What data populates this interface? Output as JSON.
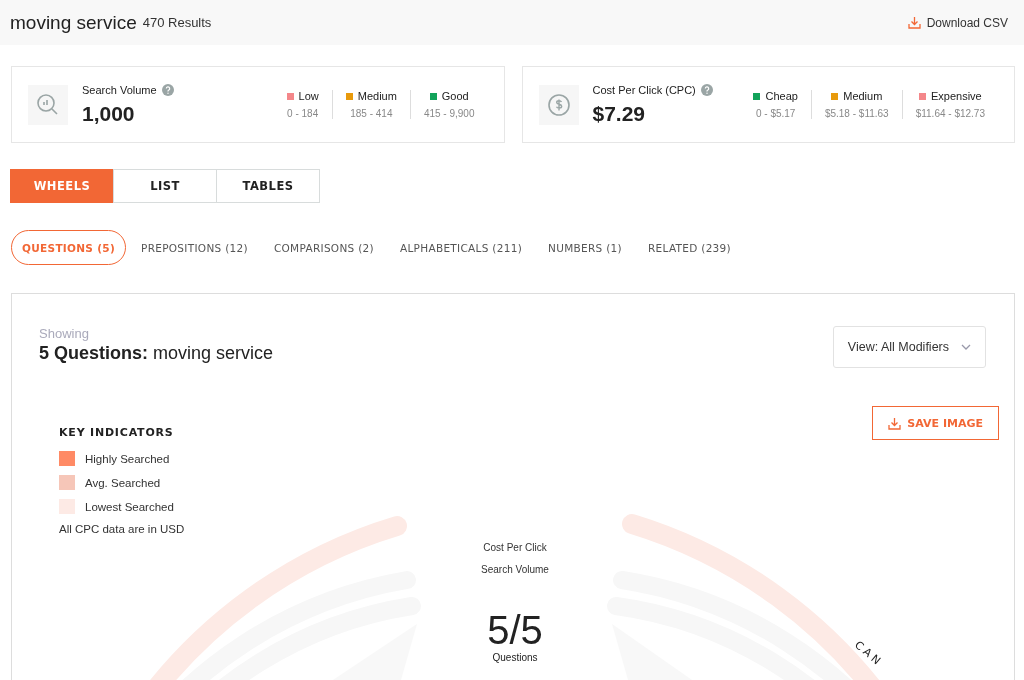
{
  "header": {
    "keyword": "moving service",
    "results": "470 Results",
    "download": "Download CSV"
  },
  "metrics": [
    {
      "kind": "volume",
      "label": "Search Volume",
      "value": "1,000",
      "ranges": [
        {
          "name": "Low",
          "range": "0 - 184",
          "color": "#f4878a"
        },
        {
          "name": "Medium",
          "range": "185 - 414",
          "color": "#e89a0c"
        },
        {
          "name": "Good",
          "range": "415 - 9,900",
          "color": "#12a35a"
        }
      ]
    },
    {
      "kind": "cpc",
      "label": "Cost Per Click (CPC)",
      "value": "$7.29",
      "ranges": [
        {
          "name": "Cheap",
          "range": "0 - $5.17",
          "color": "#12a35a"
        },
        {
          "name": "Medium",
          "range": "$5.18 - $11.63",
          "color": "#e89a0c"
        },
        {
          "name": "Expensive",
          "range": "$11.64 - $12.73",
          "color": "#f4878a"
        }
      ]
    }
  ],
  "views": [
    {
      "label": "WHEELS",
      "selected": true
    },
    {
      "label": "LIST",
      "selected": false
    },
    {
      "label": "TABLES",
      "selected": false
    }
  ],
  "categories": [
    {
      "label": "QUESTIONS (5)",
      "selected": true
    },
    {
      "label": "PREPOSITIONS (12)",
      "selected": false
    },
    {
      "label": "COMPARISONS (2)",
      "selected": false
    },
    {
      "label": "ALPHABETICALS (211)",
      "selected": false
    },
    {
      "label": "NUMBERS (1)",
      "selected": false
    },
    {
      "label": "RELATED (239)",
      "selected": false
    }
  ],
  "panel": {
    "showing": "Showing",
    "count": "5 Questions:",
    "keyword": "moving service",
    "view_select": "View: All Modifiers",
    "save": "SAVE IMAGE",
    "key_title": "KEY INDICATORS",
    "key_items": [
      {
        "label": "Highly Searched",
        "color": "#ff8a65"
      },
      {
        "label": "Avg. Searched",
        "color": "#f6c6b8"
      },
      {
        "label": "Lowest Searched",
        "color": "#fdeae5"
      }
    ],
    "key_note": "All CPC data are in USD",
    "wheel": {
      "cpc_label": "Cost Per Click",
      "volume_label": "Search Volume",
      "ratio": "5/5",
      "unit": "Questions",
      "arc_label": "CAN"
    }
  }
}
